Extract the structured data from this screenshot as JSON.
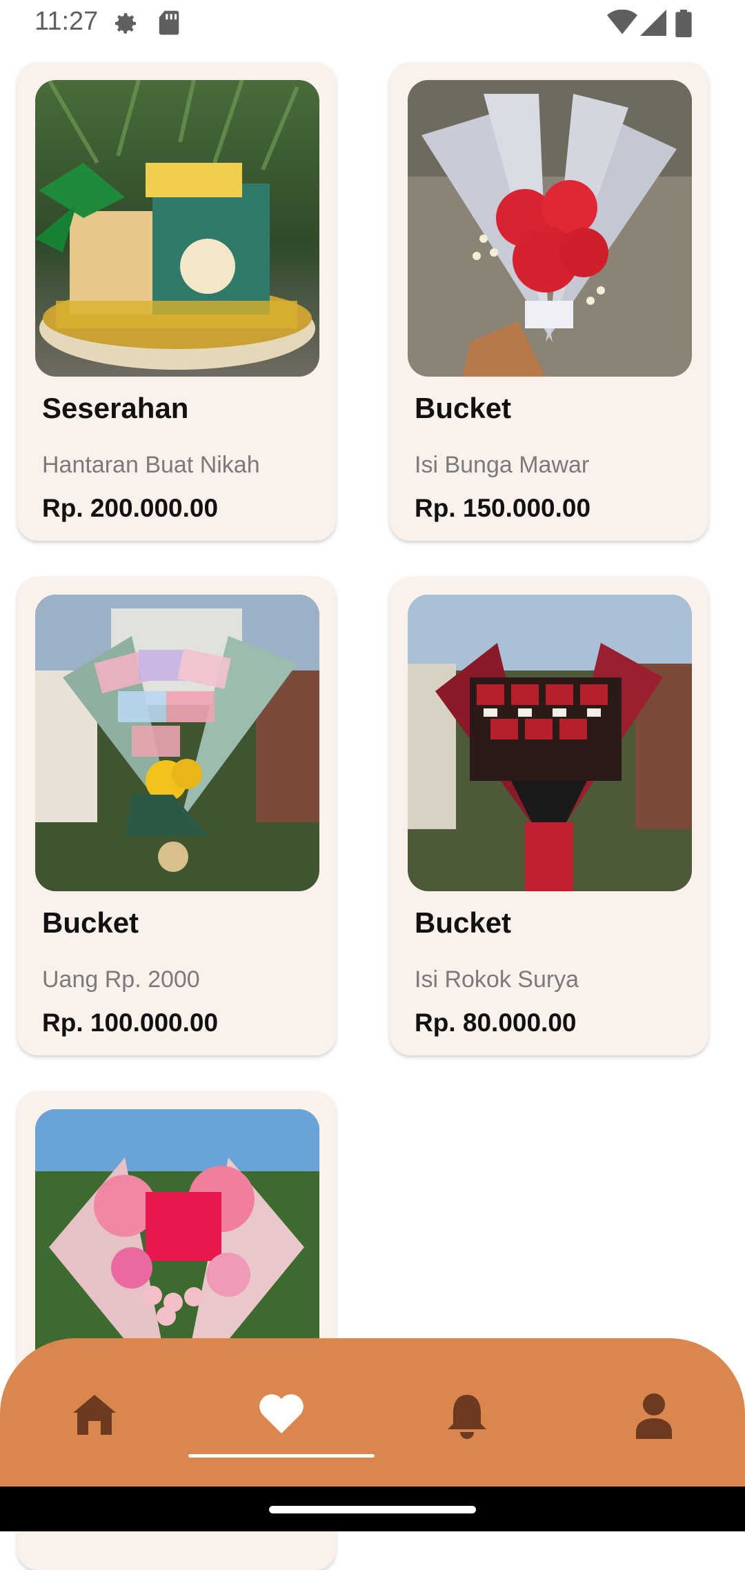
{
  "status_bar": {
    "time": "11:27",
    "icons": [
      "settings-icon",
      "sd-card-icon",
      "wifi-icon",
      "signal-icon",
      "battery-icon"
    ]
  },
  "products": [
    {
      "title": "Seserahan",
      "subtitle": "Hantaran Buat Nikah",
      "price": "Rp. 200.000.00",
      "image": "gift-hamper-photo"
    },
    {
      "title": "Bucket",
      "subtitle": "Isi Bunga Mawar",
      "price": "Rp. 150.000.00",
      "image": "rose-bouquet-photo"
    },
    {
      "title": "Bucket",
      "subtitle": "Uang Rp. 2000",
      "price": "Rp. 100.000.00",
      "image": "money-bouquet-photo"
    },
    {
      "title": "Bucket",
      "subtitle": "Isi Rokok Surya",
      "price": "Rp. 80.000.00",
      "image": "cigarette-bouquet-photo"
    },
    {
      "title": "",
      "subtitle": "",
      "price": "",
      "image": "pink-bouquet-photo"
    }
  ],
  "bottom_nav": {
    "items": [
      "home-icon",
      "heart-icon",
      "bell-icon",
      "person-icon"
    ],
    "active": "heart-icon",
    "colors": {
      "background": "#d9864f",
      "icon": "#6b3a1f",
      "active_icon": "#ffffff"
    }
  },
  "colors": {
    "card": "#fbf1ec",
    "accent": "#d9864f"
  }
}
